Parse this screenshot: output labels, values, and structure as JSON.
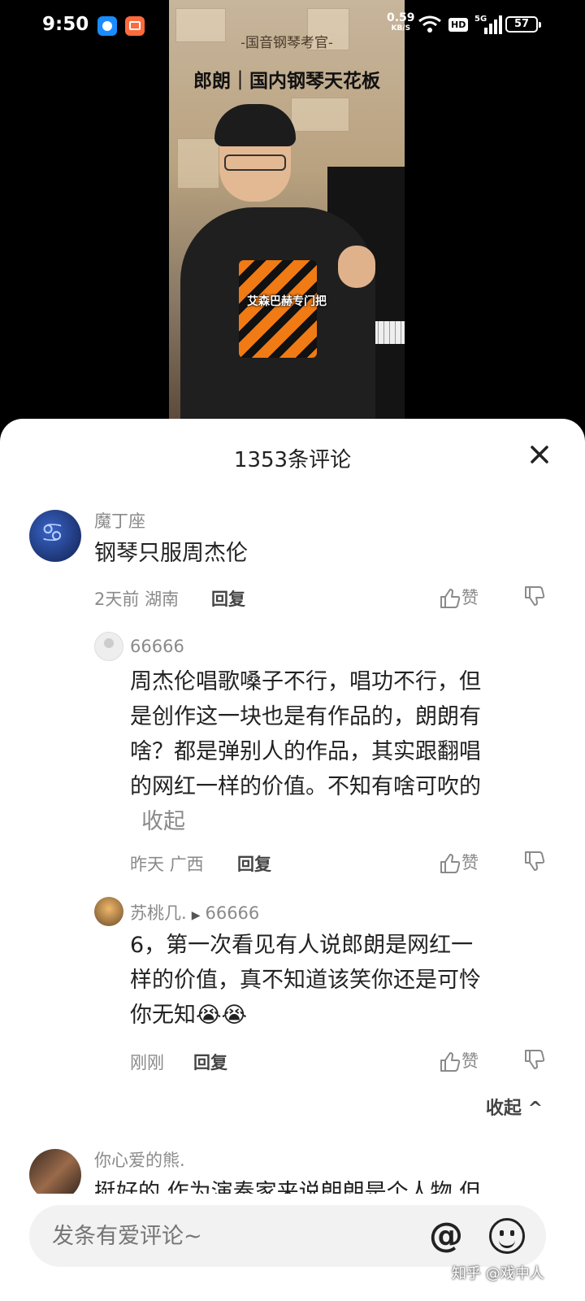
{
  "status_bar": {
    "time": "9:50",
    "net_speed": "0.59",
    "net_unit": "KB/S",
    "hd": "HD",
    "signal": "5G",
    "battery": "57"
  },
  "video": {
    "subtitle": "-国音钢琴考官-",
    "title": "郎朗｜国内钢琴天花板",
    "caption": "艾森巴赫专门把"
  },
  "comments_header": {
    "title": "1353条评论"
  },
  "comments": [
    {
      "user": "魔丁座",
      "text": "钢琴只服周杰伦",
      "time": "2天前",
      "location": "湖南",
      "reply_label": "回复",
      "like_label": "赞"
    },
    {
      "user": "66666",
      "text_lines": [
        "周杰伦唱歌嗓子不行，唱功不行，但",
        "是创作这一块也是有作品的，朗朗有",
        "啥？都是弹别人的作品，其实跟翻唱",
        "的网红一样的价值。不知有啥可吹的"
      ],
      "collapse_label": "收起",
      "time": "昨天",
      "location": "广西",
      "reply_label": "回复",
      "like_label": "赞"
    },
    {
      "user": "苏桃几.",
      "reply_to": "66666",
      "text_lines": [
        "6，第一次看见有人说郎朗是网红一",
        "样的价值，真不知道该笑你还是可怜",
        "你无知😭😭"
      ],
      "time": "刚刚",
      "reply_label": "回复",
      "like_label": "赞"
    },
    {
      "user": "你心爱的熊.",
      "text": "挺好的 作为演奏家来说朗朗是个人物 但"
    }
  ],
  "collapse_replies": "收起 ^",
  "input": {
    "placeholder": "发条有爱评论~"
  },
  "watermark": "知乎 @戏中人",
  "colors": {
    "accent_text": "#222222",
    "muted_text": "#8a8a8a",
    "sheet_bg": "#ffffff",
    "input_bg": "#f2f2f2"
  }
}
